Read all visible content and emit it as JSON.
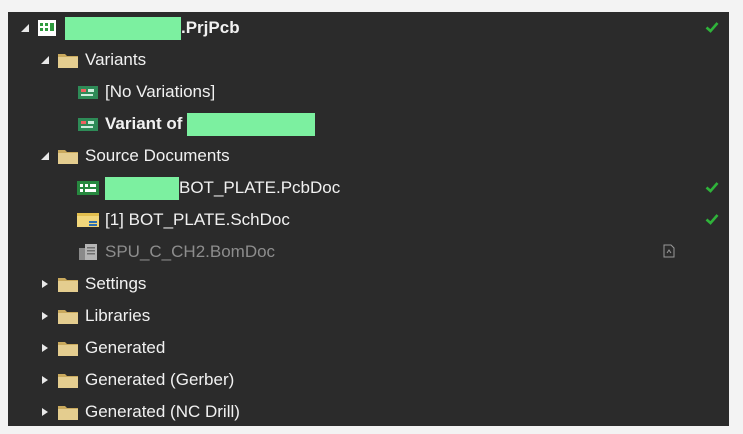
{
  "tree": {
    "project": {
      "suffix": ".PrjPcb",
      "status": "ok",
      "icon": "project-icon"
    },
    "variants": {
      "label": "Variants",
      "icon": "folder-icon",
      "items": [
        {
          "label": "[No Variations]",
          "icon": "pcb-variant-icon"
        },
        {
          "label": "Variant of ",
          "icon": "pcb-variant-icon"
        }
      ]
    },
    "source_documents": {
      "label": "Source Documents",
      "icon": "folder-icon",
      "items": [
        {
          "label": "BOT_PLATE.PcbDoc",
          "icon": "pcbdoc-icon",
          "status": "ok"
        },
        {
          "label": "[1] BOT_PLATE.SchDoc",
          "icon": "schdoc-icon",
          "status": "ok"
        },
        {
          "label": "SPU_C_CH2.BomDoc",
          "icon": "bomdoc-icon",
          "status": "not-saved"
        }
      ]
    },
    "folders": [
      {
        "label": "Settings",
        "icon": "folder-icon"
      },
      {
        "label": "Libraries",
        "icon": "folder-icon"
      },
      {
        "label": "Generated",
        "icon": "folder-icon"
      },
      {
        "label": "Generated (Gerber)",
        "icon": "folder-icon"
      },
      {
        "label": "Generated (NC Drill)",
        "icon": "folder-icon"
      }
    ]
  },
  "colors": {
    "background": "#2b2b2b",
    "text": "#f1f1f1",
    "dim_text": "#8d8d8d",
    "check": "#2fb33a",
    "folder": "#d4ba7a",
    "redaction": "#7cf0a0"
  }
}
